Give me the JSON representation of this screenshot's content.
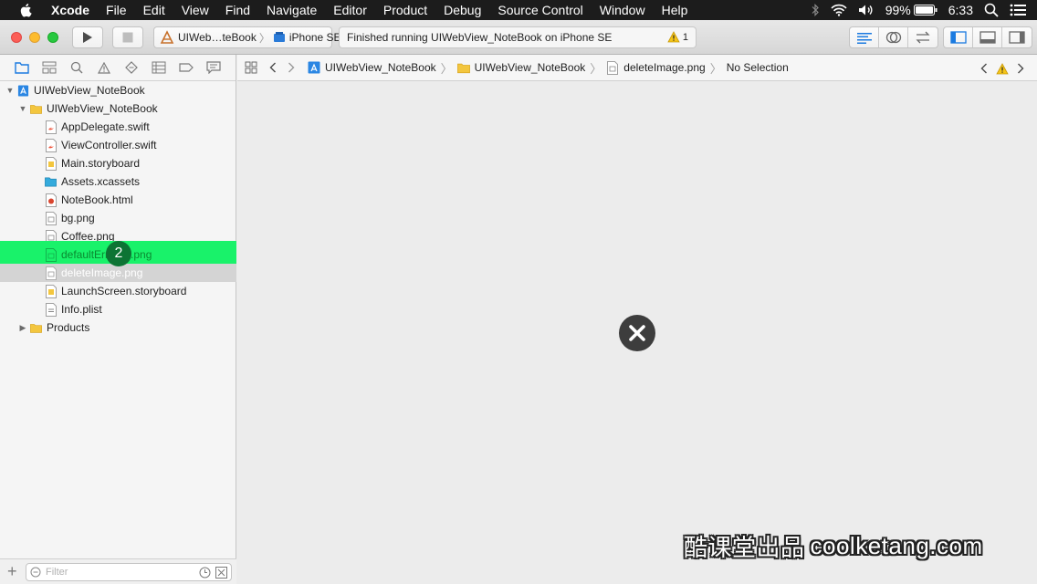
{
  "menubar": {
    "app_name": "Xcode",
    "items": [
      "File",
      "Edit",
      "View",
      "Find",
      "Navigate",
      "Editor",
      "Product",
      "Debug",
      "Source Control",
      "Window",
      "Help"
    ],
    "battery": "99%",
    "time": "6:33"
  },
  "toolbar": {
    "scheme": "UIWeb…teBook",
    "destination": "iPhone SE",
    "activity": "Finished running UIWebView_NoteBook on iPhone SE",
    "warning_count": "1"
  },
  "navigator": {
    "tree": [
      {
        "label": "UIWebView_NoteBook",
        "level": 0,
        "icon": "project-icon",
        "expanded": true
      },
      {
        "label": "UIWebView_NoteBook",
        "level": 1,
        "icon": "folder-icon",
        "expanded": true
      },
      {
        "label": "AppDelegate.swift",
        "level": 2,
        "icon": "swift-file-icon"
      },
      {
        "label": "ViewController.swift",
        "level": 2,
        "icon": "swift-file-icon"
      },
      {
        "label": "Main.storyboard",
        "level": 2,
        "icon": "storyboard-icon"
      },
      {
        "label": "Assets.xcassets",
        "level": 2,
        "icon": "asset-catalog-icon"
      },
      {
        "label": "NoteBook.html",
        "level": 2,
        "icon": "html-file-icon"
      },
      {
        "label": "bg.png",
        "level": 2,
        "icon": "image-file-icon"
      },
      {
        "label": "Coffee.png",
        "level": 2,
        "icon": "image-file-icon"
      },
      {
        "label": "defaultErr",
        "label_tail": ".png",
        "level": 2,
        "icon": "image-file-icon",
        "state": "highlight"
      },
      {
        "label": "deleteImage.png",
        "level": 2,
        "icon": "image-file-icon",
        "state": "selected"
      },
      {
        "label": "LaunchScreen.storyboard",
        "level": 2,
        "icon": "storyboard-icon"
      },
      {
        "label": "Info.plist",
        "level": 2,
        "icon": "plist-file-icon"
      },
      {
        "label": "Products",
        "level": 1,
        "icon": "folder-icon",
        "expanded": false
      }
    ],
    "step_badge": "2",
    "filter_placeholder": "Filter"
  },
  "jumpbar": {
    "crumbs": [
      "UIWebView_NoteBook",
      "UIWebView_NoteBook",
      "deleteImage.png",
      "No Selection"
    ]
  },
  "watermark": {
    "cn": "酷课堂出品",
    "en": "coolketang.com"
  },
  "colors": {
    "highlight": "#19f26a",
    "selected": "#d4d4d4",
    "accent": "#1a7ae0"
  }
}
